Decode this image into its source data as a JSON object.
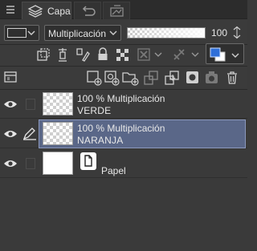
{
  "tabs": {
    "active_label": "Capa"
  },
  "blend": {
    "mode": "Multiplicación",
    "opacity": "100"
  },
  "layers": [
    {
      "opacity_mode": "100 % Multiplicación",
      "name": "VERDE",
      "visible": true,
      "selected": false
    },
    {
      "opacity_mode": "100 % Multiplicación",
      "name": "NARANJA",
      "visible": true,
      "selected": true
    },
    {
      "opacity_mode": "",
      "name": "Papel",
      "visible": true,
      "selected": false
    }
  ],
  "colors": {
    "selection_bg": "#5a6788",
    "selection_border": "#8b98bd",
    "main_color": "#2f6fd8",
    "panel_bg": "#3b3b3b"
  }
}
